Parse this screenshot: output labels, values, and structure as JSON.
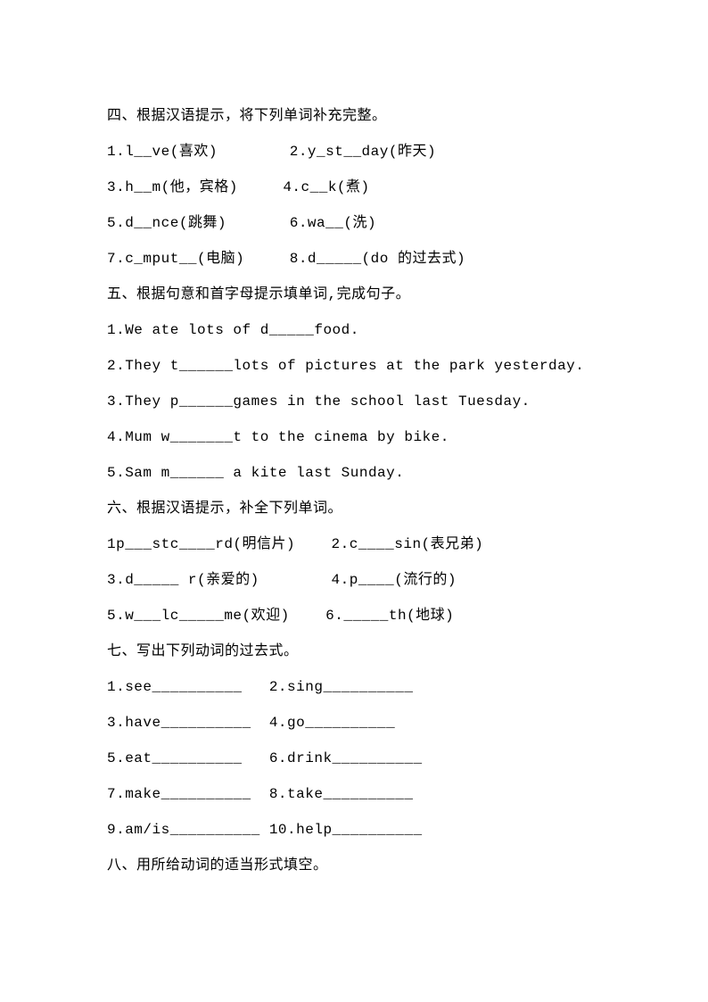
{
  "section4": {
    "title": "四、根据汉语提示，将下列单词补充完整。",
    "items": [
      "1.l__ve(喜欢)        2.y_st__day(昨天)",
      "3.h__m(他，宾格)     4.c__k(煮)",
      "5.d__nce(跳舞)       6.wa__(洗)",
      "7.c_mput__(电脑)     8.d_____(do 的过去式)"
    ]
  },
  "section5": {
    "title": "五、根据句意和首字母提示填单词,完成句子。",
    "items": [
      "1.We ate lots of d_____food.",
      "2.They t______lots of pictures at the park yesterday.",
      "3.They p______games in the school last Tuesday.",
      "4.Mum w_______t to the cinema by bike.",
      "5.Sam m______ a kite last Sunday."
    ]
  },
  "section6": {
    "title": "六、根据汉语提示，补全下列单词。",
    "items": [
      "1p___stc____rd(明信片)    2.c____sin(表兄弟)",
      "3.d_____ r(亲爱的)        4.p____(流行的)",
      "5.w___lc_____me(欢迎)    6._____th(地球)"
    ]
  },
  "section7": {
    "title": "七、写出下列动词的过去式。",
    "items": [
      "1.see__________   2.sing__________",
      "3.have__________  4.go__________",
      "5.eat__________   6.drink__________",
      "7.make__________  8.take__________",
      "9.am/is__________ 10.help__________"
    ]
  },
  "section8": {
    "title": "八、用所给动词的适当形式填空。"
  }
}
